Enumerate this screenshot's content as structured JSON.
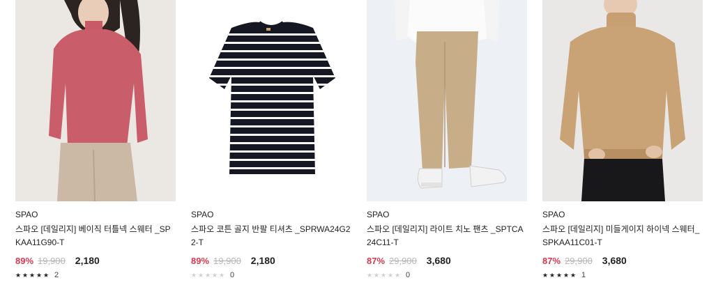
{
  "products": [
    {
      "brand": "SPAO",
      "name": "스파오 [데일리지] 베이직 터틀넥 스웨터 _SPKAA11G90-T",
      "discount_rate": "89%",
      "original_price": "19,900",
      "sale_price": "2,180",
      "rating_stars": 5,
      "review_count": "2",
      "image": "pink-turtleneck-sweater-photo"
    },
    {
      "brand": "SPAO",
      "name": "스파오 코튼 골지 반팔 티셔츠 _SPRWA24G22-T",
      "discount_rate": "89%",
      "original_price": "19,900",
      "sale_price": "2,180",
      "rating_stars": 0,
      "review_count": "0",
      "image": "striped-tshirt-photo"
    },
    {
      "brand": "SPAO",
      "name": "스파오 [데일리지] 라이트 치노 팬츠 _SPTCA24C11-T",
      "discount_rate": "87%",
      "original_price": "29,900",
      "sale_price": "3,680",
      "rating_stars": 0,
      "review_count": "0",
      "image": "beige-chino-pants-photo"
    },
    {
      "brand": "SPAO",
      "name": "스파오 [데일리지] 미들게이지 하이넥 스웨터_SPKAA11C01-T",
      "discount_rate": "87%",
      "original_price": "29,900",
      "sale_price": "3,680",
      "rating_stars": 5,
      "review_count": "1",
      "image": "camel-highneck-sweater-photo"
    }
  ],
  "colors": {
    "discount": "#d8394f",
    "original_price": "#b5b5b5",
    "star_on": "#222222",
    "star_off": "#cfcfcf"
  }
}
